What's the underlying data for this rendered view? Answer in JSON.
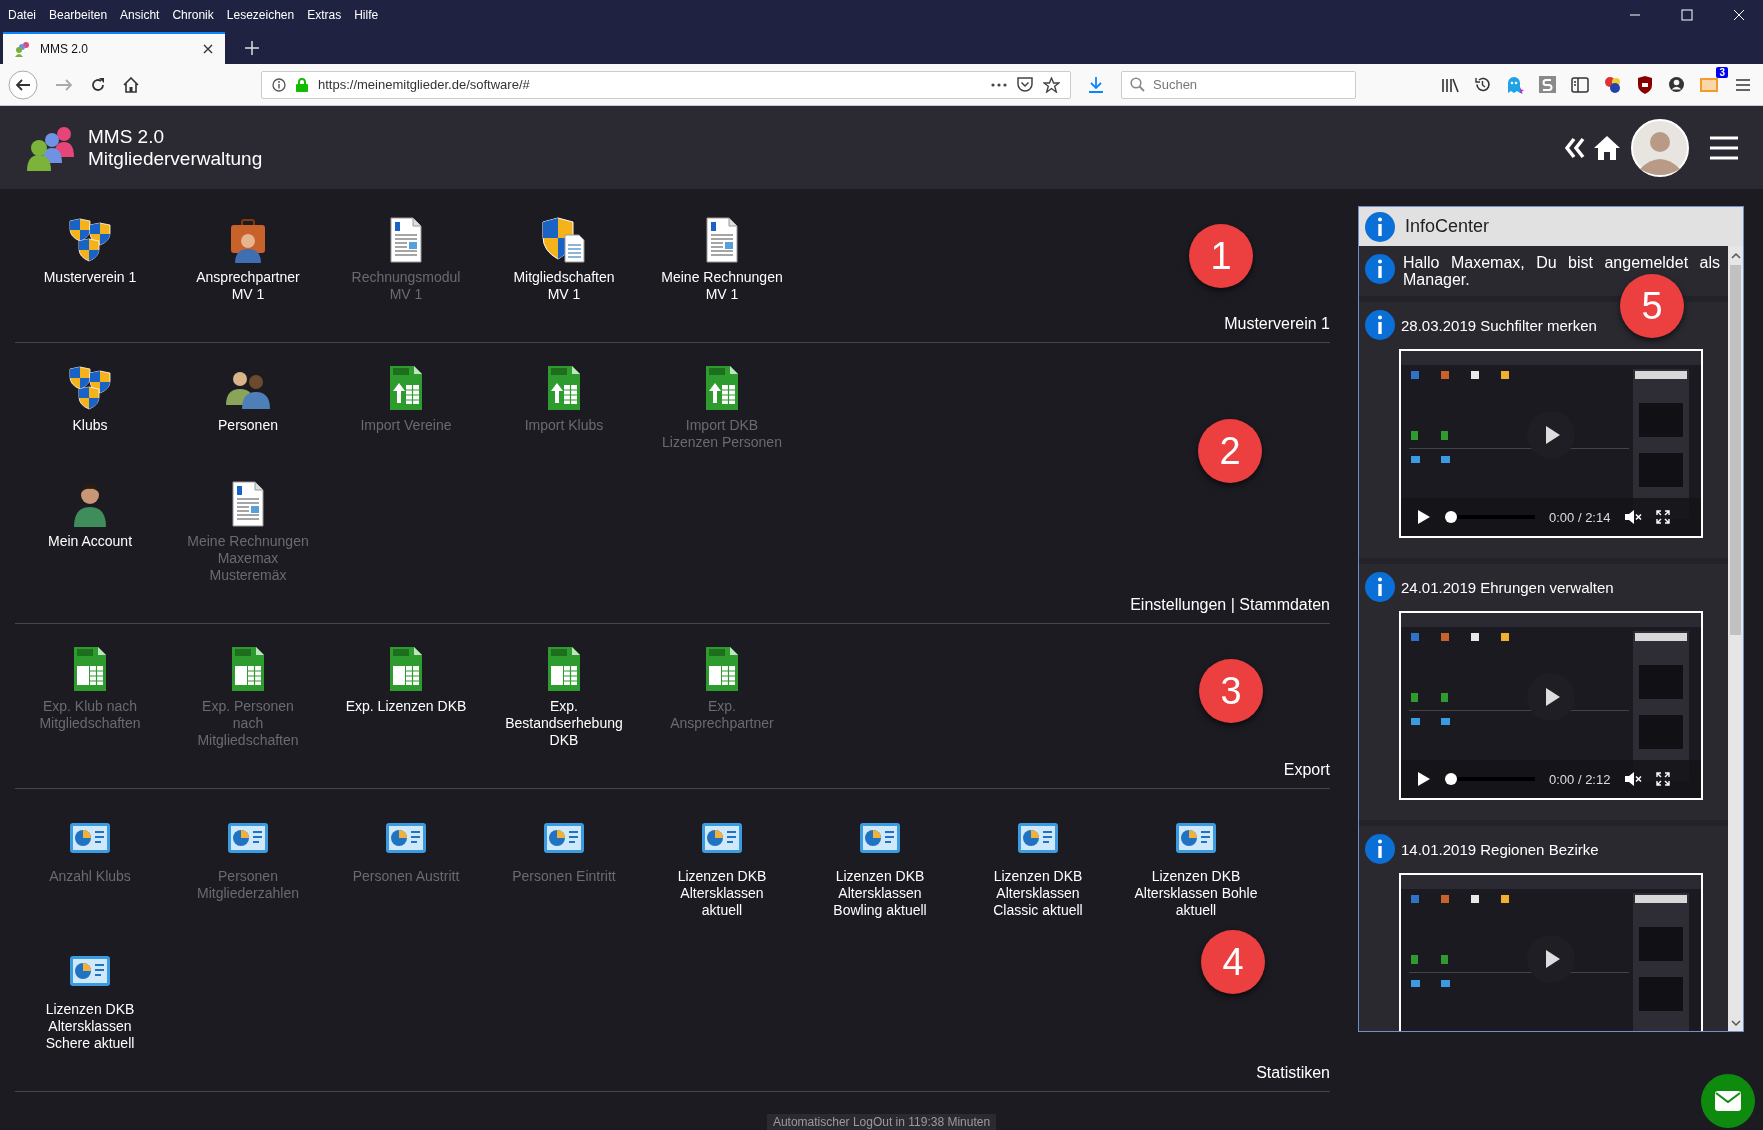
{
  "browser": {
    "menu": [
      "Datei",
      "Bearbeiten",
      "Ansicht",
      "Chronik",
      "Lesezeichen",
      "Extras",
      "Hilfe"
    ],
    "tabs": [
      {
        "title": "MMS 2.0",
        "selected": true
      }
    ],
    "url": "https://meinemitglieder.de/software/#",
    "search": {
      "placeholder": "Suchen"
    },
    "badge": "3"
  },
  "app": {
    "title": "MMS 2.0",
    "subtitle": "Mitgliederverwaltung"
  },
  "sections": [
    {
      "title": "Musterverein 1",
      "marker": "1",
      "rows": [
        [
          {
            "label": "Musterverein 1",
            "kind": "shields",
            "disabled": false
          },
          {
            "label": "Ansprechpartner\nMV 1",
            "kind": "briefcase-person",
            "disabled": false
          },
          {
            "label": "Rechnungsmodul\nMV 1",
            "kind": "document",
            "disabled": true
          },
          {
            "label": "Mitgliedschaften\nMV 1",
            "kind": "shield-document",
            "disabled": false
          },
          {
            "label": "Meine Rechnungen\nMV 1",
            "kind": "document",
            "disabled": false
          }
        ]
      ]
    },
    {
      "title": "Einstellungen | Stammdaten",
      "marker": "2",
      "rows": [
        [
          {
            "label": "Klubs",
            "kind": "shields",
            "disabled": false
          },
          {
            "label": "Personen",
            "kind": "people",
            "disabled": false
          },
          {
            "label": "Import Vereine",
            "kind": "spreadsheet-upload",
            "disabled": true
          },
          {
            "label": "Import Klubs",
            "kind": "spreadsheet-upload",
            "disabled": true
          },
          {
            "label": "Import DKB\nLizenzen Personen",
            "kind": "spreadsheet-upload",
            "disabled": true
          }
        ],
        [
          {
            "label": "Mein Account",
            "kind": "person",
            "disabled": false
          },
          {
            "label": "Meine Rechnungen\nMaxemax\nMusteremäx",
            "kind": "document",
            "disabled": true
          }
        ]
      ]
    },
    {
      "title": "Export",
      "marker": "3",
      "rows": [
        [
          {
            "label": "Exp. Klub nach\nMitgliedschaften",
            "kind": "spreadsheet",
            "disabled": true
          },
          {
            "label": "Exp. Personen\nnach\nMitgliedschaften",
            "kind": "spreadsheet",
            "disabled": true
          },
          {
            "label": "Exp. Lizenzen DKB",
            "kind": "spreadsheet",
            "disabled": false
          },
          {
            "label": "Exp.\nBestandserhebung\nDKB",
            "kind": "spreadsheet",
            "disabled": false
          },
          {
            "label": "Exp.\nAnsprechpartner",
            "kind": "spreadsheet",
            "disabled": true
          }
        ]
      ]
    },
    {
      "title": "Statistiken",
      "marker": "4",
      "rows": [
        [
          {
            "label": "Anzahl Klubs",
            "kind": "chart",
            "disabled": true
          },
          {
            "label": "Personen\nMitgliederzahlen",
            "kind": "chart",
            "disabled": true
          },
          {
            "label": "Personen Austritt",
            "kind": "chart",
            "disabled": true
          },
          {
            "label": "Personen Eintritt",
            "kind": "chart",
            "disabled": true
          },
          {
            "label": "Lizenzen DKB\nAltersklassen\naktuell",
            "kind": "chart",
            "disabled": false
          },
          {
            "label": "Lizenzen DKB\nAltersklassen\nBowling aktuell",
            "kind": "chart",
            "disabled": false
          },
          {
            "label": "Lizenzen DKB\nAltersklassen\nClassic aktuell",
            "kind": "chart",
            "disabled": false
          },
          {
            "label": "Lizenzen DKB\nAltersklassen Bohle\naktuell",
            "kind": "chart",
            "disabled": false
          }
        ],
        [
          {
            "label": "Lizenzen DKB\nAltersklassen\nSchere aktuell",
            "kind": "chart",
            "disabled": false
          }
        ]
      ]
    }
  ],
  "info_center": {
    "title": "InfoCenter",
    "marker": "5",
    "greeting": "Hallo Maxemax, Du bist angemeldet als Manager.",
    "entries": [
      {
        "title": "28.03.2019 Suchfilter merken",
        "kind": "video",
        "video": {
          "time": "0:00 / 2:14",
          "level": 0
        }
      },
      {
        "title": "24.01.2019 Ehrungen verwalten",
        "kind": "video",
        "video": {
          "time": "0:00 / 2:12",
          "level": 0
        }
      },
      {
        "title": "14.01.2019 Regionen Bezirke",
        "kind": "video"
      }
    ]
  },
  "logout": "Automatischer LogOut in 119:38 Minuten"
}
